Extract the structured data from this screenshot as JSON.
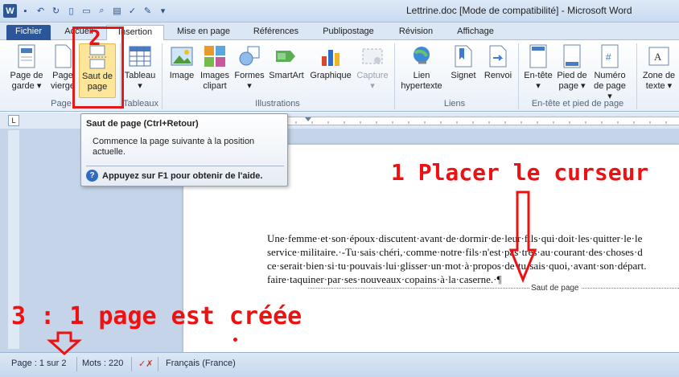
{
  "window": {
    "title": "Lettrine.doc [Mode de compatibilité] - Microsoft Word"
  },
  "tabs": [
    "Fichier",
    "Accueil",
    "Insertion",
    "Mise en page",
    "Références",
    "Publipostage",
    "Révision",
    "Affichage"
  ],
  "ribbon": {
    "buttons": [
      {
        "label": "Page de\ngarde ▾"
      },
      {
        "label": "Page\nvierge"
      },
      {
        "label": "Saut de\npage"
      },
      {
        "label": "Tableau\n▾"
      },
      {
        "label": "Image"
      },
      {
        "label": "Images\nclipart"
      },
      {
        "label": "Formes\n▾"
      },
      {
        "label": "SmartArt"
      },
      {
        "label": "Graphique"
      },
      {
        "label": "Capture\n▾"
      },
      {
        "label": "Lien\nhypertexte"
      },
      {
        "label": "Signet"
      },
      {
        "label": "Renvoi"
      },
      {
        "label": "En-tête\n▾"
      },
      {
        "label": "Pied de\npage ▾"
      },
      {
        "label": "Numéro\nde page ▾"
      },
      {
        "label": "Zone de\ntexte ▾"
      }
    ],
    "groups": [
      "Page",
      "Tableaux",
      "Illustrations",
      "Liens",
      "En-tête et pied de page"
    ]
  },
  "tooltip": {
    "title": "Saut de page (Ctrl+Retour)",
    "description": "Commence la page suivante à la position actuelle.",
    "help": "Appuyez sur F1 pour obtenir de l'aide."
  },
  "document": {
    "lines": [
      "Une·femme·et·son·époux·discutent·avant·de·dormir·de·leur·fils·qui·doit·les·quitter·le·le",
      "service·militaire.·-Tu·sais·chéri,·comme·notre·fils·n'est·pas·très·au·courant·des·choses·d",
      "ce·serait·bien·si·tu·pouvais·lui·glisser·un·mot·à·propos·de·tu·sais·quoi,·avant·son·départ.",
      "faire·taquiner·par·ses·nouveaux·copains·à·la·caserne.·¶"
    ],
    "page_break_label": "Saut de page"
  },
  "status": {
    "page": "Page : 1 sur 2",
    "words": "Mots : 220",
    "language": "Français (France)"
  },
  "annotations": {
    "step1": "1 Placer le curseur",
    "step2": "2",
    "step3": "3 : 1 page est créée"
  },
  "colors": {
    "annotation": "#ee1111",
    "file_tab": "#2b579a",
    "highlight": "#fde69a"
  }
}
